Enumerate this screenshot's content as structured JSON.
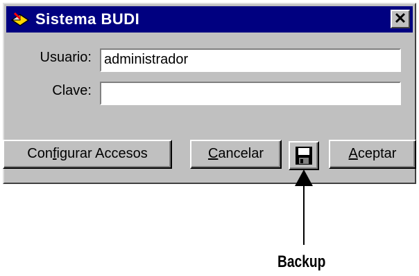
{
  "window": {
    "title": "Sistema BUDI",
    "close_symbol": "✕"
  },
  "form": {
    "usuario_label": "Usuario:",
    "usuario_value": "administrador",
    "clave_label": "Clave:",
    "clave_value": ""
  },
  "buttons": {
    "configurar_pre": "Con",
    "configurar_mnemonic": "f",
    "configurar_post": "igurar Accesos",
    "cancelar_mnemonic": "C",
    "cancelar_post": "ancelar",
    "aceptar_mnemonic": "A",
    "aceptar_post": "ceptar",
    "backup_icon": "floppy-disk-icon"
  },
  "annotation": {
    "label": "Backup"
  }
}
